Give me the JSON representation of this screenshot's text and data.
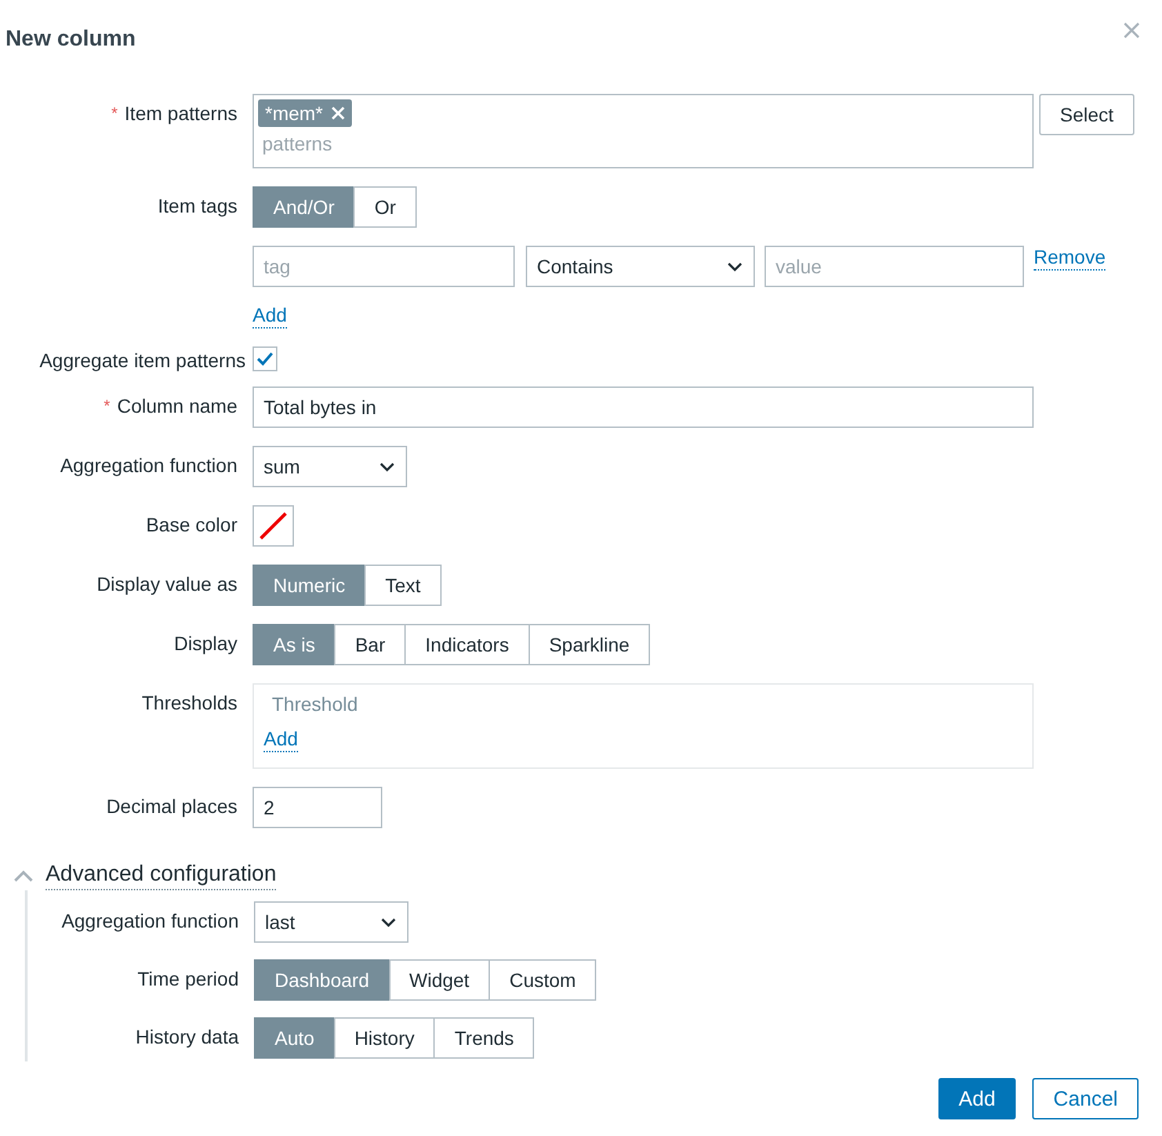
{
  "dialog": {
    "title": "New column"
  },
  "form": [
    {
      "kind": "multiselect",
      "label": "Item patterns",
      "required_mark": "*",
      "chips": [
        "*mem*"
      ],
      "placeholder": "patterns",
      "button": "Select"
    },
    {
      "kind": "segmented",
      "label": "Item tags",
      "options": [
        {
          "label": "And/Or",
          "selected": true
        },
        {
          "label": "Or",
          "selected": false
        }
      ]
    },
    {
      "kind": "tagfilter",
      "tag_placeholder": "tag",
      "operator": "Contains",
      "value_placeholder": "value",
      "remove": "Remove",
      "add": "Add"
    },
    {
      "kind": "checkbox",
      "label": "Aggregate item patterns",
      "checked": true
    },
    {
      "kind": "text",
      "label": "Column name",
      "required_mark": "*",
      "value": "Total bytes in"
    },
    {
      "kind": "select",
      "label": "Aggregation function",
      "value": "sum"
    },
    {
      "kind": "color",
      "label": "Base color"
    },
    {
      "kind": "segmented",
      "label": "Display value as",
      "options": [
        {
          "label": "Numeric",
          "selected": true
        },
        {
          "label": "Text",
          "selected": false
        }
      ]
    },
    {
      "kind": "segmented",
      "label": "Display",
      "options": [
        {
          "label": "As is",
          "selected": true
        },
        {
          "label": "Bar",
          "selected": false
        },
        {
          "label": "Indicators",
          "selected": false
        },
        {
          "label": "Sparkline",
          "selected": false
        }
      ]
    },
    {
      "kind": "thresholds",
      "label": "Thresholds",
      "header": "Threshold",
      "add": "Add"
    },
    {
      "kind": "number",
      "label": "Decimal places",
      "value": "2"
    }
  ],
  "advanced": {
    "title": "Advanced configuration",
    "expanded": true,
    "fields": [
      {
        "kind": "select",
        "label": "Aggregation function",
        "value": "last"
      },
      {
        "kind": "segmented",
        "label": "Time period",
        "options": [
          {
            "label": "Dashboard",
            "selected": true
          },
          {
            "label": "Widget",
            "selected": false
          },
          {
            "label": "Custom",
            "selected": false
          }
        ]
      },
      {
        "kind": "segmented",
        "label": "History data",
        "options": [
          {
            "label": "Auto",
            "selected": true
          },
          {
            "label": "History",
            "selected": false
          },
          {
            "label": "Trends",
            "selected": false
          }
        ]
      }
    ]
  },
  "buttons": [
    {
      "label": "Add",
      "primary": true
    },
    {
      "label": "Cancel",
      "primary": false
    }
  ]
}
